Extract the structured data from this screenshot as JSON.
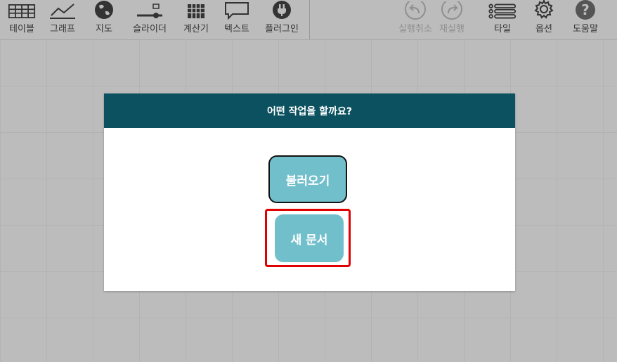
{
  "toolbar": {
    "tools": [
      {
        "label": "테이블",
        "icon": "table-icon"
      },
      {
        "label": "그래프",
        "icon": "graph-icon"
      },
      {
        "label": "지도",
        "icon": "globe-icon"
      },
      {
        "label": "슬라이더",
        "icon": "slider-icon"
      },
      {
        "label": "계산기",
        "icon": "calculator-icon"
      },
      {
        "label": "텍스트",
        "icon": "speech-bubble-icon"
      },
      {
        "label": "플러그인",
        "icon": "plug-icon"
      }
    ],
    "undo_label": "실행취소",
    "redo_label": "재실행",
    "tile_label": "타일",
    "options_label": "옵션",
    "help_label": "도움말",
    "help_glyph": "?"
  },
  "dialog": {
    "title": "어떤 작업을 할까요?",
    "open_label": "불러오기",
    "new_label": "새 문서"
  },
  "colors": {
    "header": "#0b5160",
    "button": "#72bfcc",
    "highlight": "#e00000",
    "background": "#bcbcbc"
  }
}
